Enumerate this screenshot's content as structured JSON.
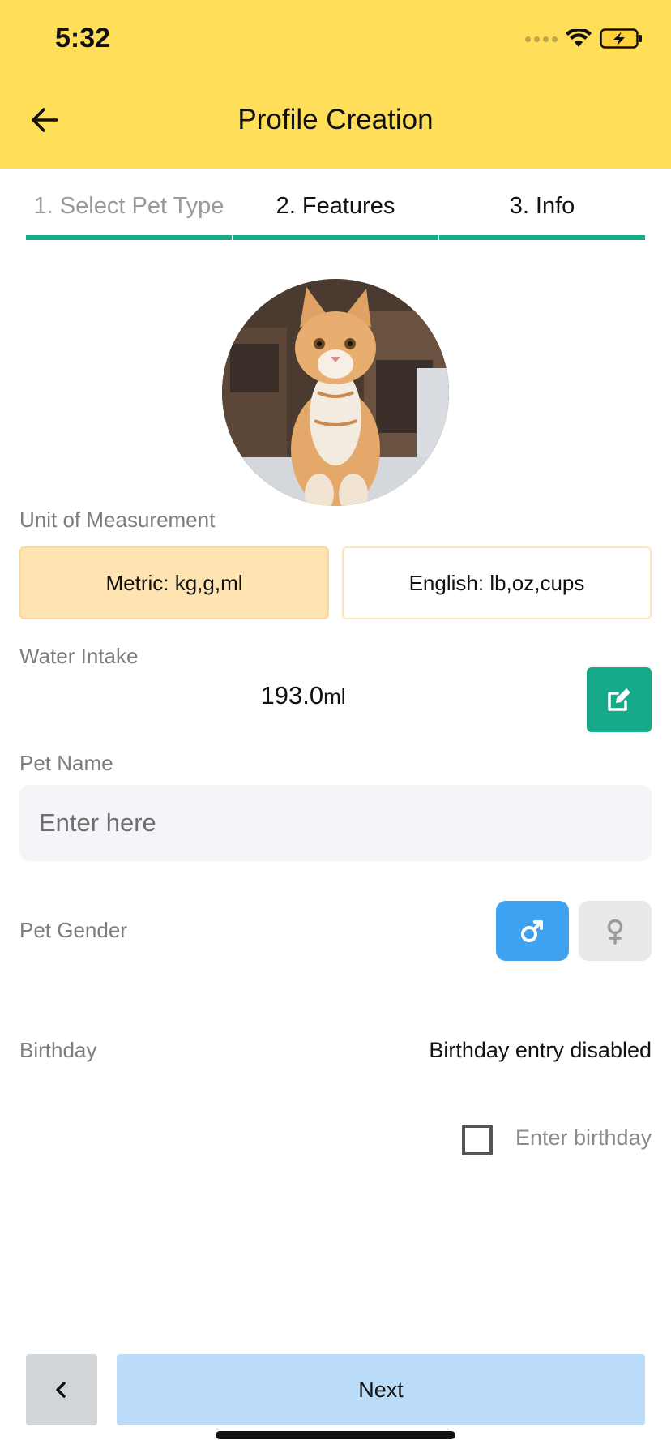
{
  "status_bar": {
    "time": "5:32"
  },
  "header": {
    "title": "Profile Creation"
  },
  "tabs": [
    {
      "label": "1. Select Pet Type"
    },
    {
      "label": "2. Features"
    },
    {
      "label": "3. Info"
    }
  ],
  "colors": {
    "header_bg": "#FFDE59",
    "accent_green": "#16A98A",
    "metric_selected": "#FFE3B0",
    "male_selected": "#3FA2F0",
    "next_button": "#BBDDF9"
  },
  "unit": {
    "label": "Unit of Measurement",
    "metric_label": "Metric: kg,g,ml",
    "english_label": "English: lb,oz,cups",
    "selected": "metric"
  },
  "water": {
    "label": "Water Intake",
    "value": "193.0",
    "unit": "ml"
  },
  "pet_name": {
    "label": "Pet Name",
    "placeholder": "Enter here",
    "value": ""
  },
  "gender": {
    "label": "Pet Gender",
    "selected": "male",
    "male_icon": "male-symbol-icon",
    "female_icon": "female-symbol-icon"
  },
  "birthday": {
    "label": "Birthday",
    "status": "Birthday entry disabled",
    "checkbox_label": "Enter birthday",
    "checked": false
  },
  "footer": {
    "back_icon": "chevron-left-icon",
    "next_label": "Next"
  }
}
